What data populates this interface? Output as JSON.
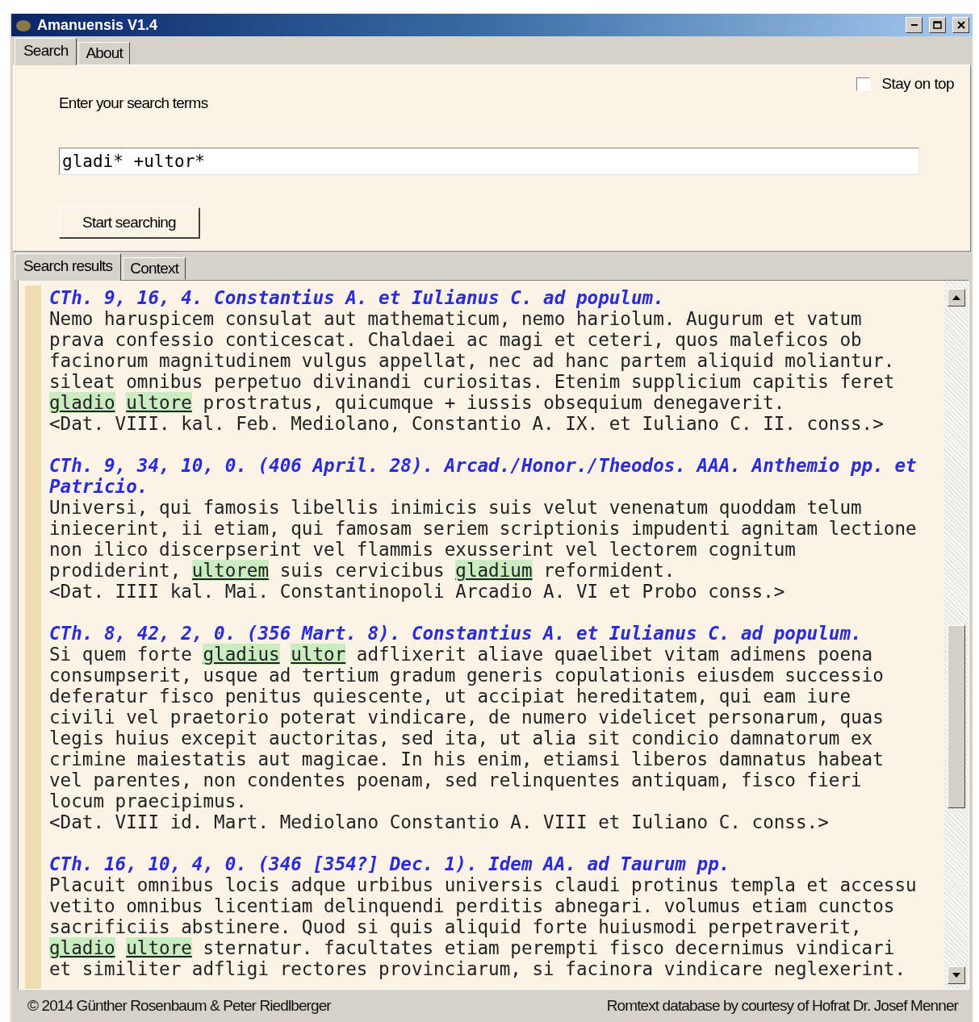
{
  "window": {
    "title": "Amanuensis V1.4"
  },
  "tabs": [
    {
      "label": "Search",
      "selected": true
    },
    {
      "label": "About",
      "selected": false
    }
  ],
  "search_panel": {
    "prompt": "Enter your search terms",
    "query": "gladi* +ultor*",
    "stay_on_top": {
      "label": "Stay on top",
      "checked": false
    },
    "button": "Start searching"
  },
  "result_tabs": [
    {
      "label": "Search results",
      "selected": true
    },
    {
      "label": "Context",
      "selected": false
    }
  ],
  "results": [
    {
      "heading": [
        "CTh. 9, 16, 4. Constantius A. et Iulianus C. ad populum."
      ],
      "lines": [
        [
          {
            "t": "Nemo haruspicem consulat aut mathematicum, nemo hariolum. Augurum et vatum",
            "match": false
          }
        ],
        [
          {
            "t": "prava confessio conticescat. Chaldaei ac magi et ceteri, quos maleficos ob",
            "match": false
          }
        ],
        [
          {
            "t": "facinorum magnitudinem vulgus appellat, nec ad hanc partem aliquid moliantur.",
            "match": false
          }
        ],
        [
          {
            "t": "sileat omnibus perpetuo divinandi curiositas. Etenim supplicium capitis feret",
            "match": false
          }
        ],
        [
          {
            "t": "gladio",
            "match": true
          },
          {
            "t": "ultore",
            "match": true
          },
          {
            "t": " prostratus, quicumque + iussis obsequium denegaverit.",
            "match": false
          }
        ],
        [
          {
            "t": "<Dat. VIII. kal. Feb. Mediolano, Constantio A. IX. et Iuliano C. II. conss.>",
            "match": false
          }
        ]
      ]
    },
    {
      "heading": [
        "CTh. 9, 34, 10, 0. (406 April. 28). Arcad./Honor./Theodos. AAA. Anthemio pp. et",
        "Patricio."
      ],
      "lines": [
        [
          {
            "t": "Universi, qui famosis libellis inimicis suis velut venenatum quoddam telum",
            "match": false
          }
        ],
        [
          {
            "t": "iniecerint, ii etiam, qui famosam seriem scriptionis impudenti agnitam lectione",
            "match": false
          }
        ],
        [
          {
            "t": "non ilico discerpserint vel flammis exusserint vel lectorem cognitum",
            "match": false
          }
        ],
        [
          {
            "t": "prodiderint, ",
            "match": false
          },
          {
            "t": "ultorem",
            "match": true
          },
          {
            "t": " suis cervicibus ",
            "match": false
          },
          {
            "t": "gladium",
            "match": true
          },
          {
            "t": " reformident.",
            "match": false
          }
        ],
        [
          {
            "t": "<Dat. IIII kal. Mai. Constantinopoli Arcadio A. VI et Probo conss.>",
            "match": false
          }
        ]
      ]
    },
    {
      "heading": [
        "CTh. 8, 42, 2, 0. (356 Mart. 8). Constantius A. et Iulianus C. ad populum."
      ],
      "lines": [
        [
          {
            "t": "Si quem forte ",
            "match": false
          },
          {
            "t": "gladius",
            "match": true
          },
          {
            "t": "ultor",
            "match": true
          },
          {
            "t": " adflixerit aliave quaelibet vitam adimens poena",
            "match": false
          }
        ],
        [
          {
            "t": "consumpserit, usque ad tertium gradum generis copulationis eiusdem successio",
            "match": false
          }
        ],
        [
          {
            "t": "deferatur fisco penitus quiescente, ut accipiat hereditatem, qui eam iure",
            "match": false
          }
        ],
        [
          {
            "t": "civili vel praetorio poterat vindicare, de numero videlicet personarum, quas",
            "match": false
          }
        ],
        [
          {
            "t": "legis huius excepit auctoritas, sed ita, ut alia sit condicio damnatorum ex",
            "match": false
          }
        ],
        [
          {
            "t": "crimine maiestatis aut magicae. In his enim, etiamsi liberos damnatus habeat",
            "match": false
          }
        ],
        [
          {
            "t": "vel parentes, non condentes poenam, sed relinquentes antiquam, fisco fieri",
            "match": false
          }
        ],
        [
          {
            "t": "locum praecipimus.",
            "match": false
          }
        ],
        [
          {
            "t": "<Dat. VIII id. Mart. Mediolano Constantio A. VIII et Iuliano C. conss.>",
            "match": false
          }
        ]
      ]
    },
    {
      "heading": [
        "CTh. 16, 10, 4, 0. (346 [354?] Dec. 1). Idem AA. ad Taurum pp."
      ],
      "lines": [
        [
          {
            "t": "Placuit omnibus locis adque urbibus universis claudi protinus templa et accessu",
            "match": false
          }
        ],
        [
          {
            "t": "vetito omnibus licentiam delinquendi perditis abnegari. volumus etiam cunctos",
            "match": false
          }
        ],
        [
          {
            "t": "sacrificiis abstinere. Quod si quis aliquid forte huiusmodi perpetraverit,",
            "match": false
          }
        ],
        [
          {
            "t": "gladio",
            "match": true
          },
          {
            "t": "ultore",
            "match": true
          },
          {
            "t": " sternatur. facultates etiam perempti fisco decernimus vindicari",
            "match": false
          }
        ],
        [
          {
            "t": "et similiter adfligi rectores provinciarum, si facinora vindicare neglexerint.",
            "match": false
          }
        ]
      ]
    }
  ],
  "status_bar": {
    "left": "© 2014 Günther Rosenbaum & Peter Riedlberger",
    "right": "Romtext database by courtesy of Hofrat Dr. Josef Menner"
  }
}
